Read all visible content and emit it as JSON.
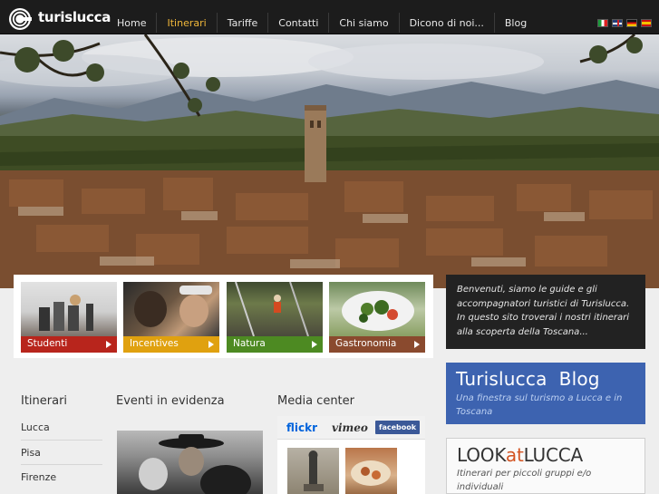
{
  "brand": {
    "name": "turislucca"
  },
  "nav": {
    "items": [
      {
        "label": "Home",
        "active": false
      },
      {
        "label": "Itinerari",
        "active": true
      },
      {
        "label": "Tariffe",
        "active": false
      },
      {
        "label": "Contatti",
        "active": false
      },
      {
        "label": "Chi siamo",
        "active": false
      },
      {
        "label": "Dicono di noi...",
        "active": false
      },
      {
        "label": "Blog",
        "active": false
      }
    ],
    "active_color": "#f0b73a"
  },
  "languages": [
    "italian-flag",
    "english-flag",
    "german-flag",
    "spanish-flag"
  ],
  "categories": [
    {
      "label": "Studenti",
      "color": "#b8251c"
    },
    {
      "label": "Incentives",
      "color": "#e0a10f"
    },
    {
      "label": "Natura",
      "color": "#4d8a22"
    },
    {
      "label": "Gastronomia",
      "color": "#8a4a2e"
    }
  ],
  "welcome": {
    "text": "Benvenuti, siamo le guide e gli accompagnatori turistici di Turislucca. In questo sito troverai i nostri itinerari alla scoperta della Toscana..."
  },
  "itinerari": {
    "title": "Itinerari",
    "items": [
      "Lucca",
      "Pisa",
      "Firenze"
    ]
  },
  "eventi": {
    "title": "Eventi in evidenza"
  },
  "media": {
    "title": "Media center",
    "tabs": {
      "flickr": "flickr",
      "vimeo": "vimeo",
      "facebook": "facebook"
    }
  },
  "blog": {
    "title": "Turislucca  Blog",
    "subtitle": "Una finestra sul turismo a Lucca e in Toscana",
    "color": "#3d63b0"
  },
  "look": {
    "title_a": "LOOK",
    "title_b": "at",
    "title_c": "LUCCA",
    "subtitle": "Itinerari per piccoli gruppi e/o individuali",
    "accent": "#d35422"
  }
}
